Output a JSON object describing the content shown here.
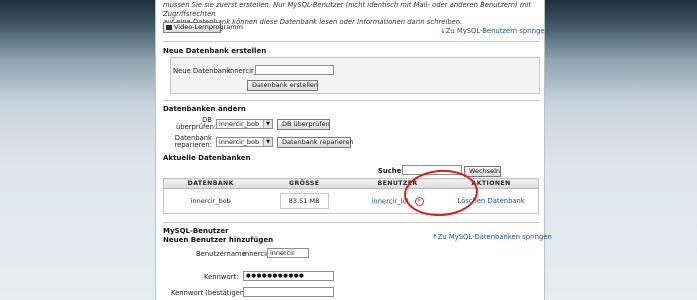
{
  "intro": {
    "line1": "müssen Sie sie zuerst erstellen. Nur MySQL-Benutzer (nicht identisch mit Mail- oder anderen Benutzern) mit Zugriffsrechten",
    "line2": "auf eine Datenbank können diese Datenbank lesen oder Informationen darin schreiben."
  },
  "video_button": "Video-Lernprogramm",
  "jump_users_link": "Zu MySQL-Benutzern springen",
  "create_db": {
    "heading": "Neue Datenbank erstellen",
    "label": "Neue Datenbank:",
    "prefix": "innercir_",
    "value": "",
    "button": "Datenbank erstellen"
  },
  "modify_db": {
    "heading": "Datenbanken ändern",
    "check_label_1": "DB",
    "check_label_2": "überprüfen:",
    "check_select": "innercir_bob",
    "check_button": "DB überprüfen",
    "repair_label_1": "Datenbank",
    "repair_label_2": "reparieren:",
    "repair_select": "innercir_bob",
    "repair_button": "Datenbank reparieren"
  },
  "current_db": {
    "heading": "Aktuelle Datenbanken",
    "search_label": "Suchen",
    "search_value": "",
    "search_button": "Wechseln",
    "columns": [
      "DATENBANK",
      "GRÖSSE",
      "BENUTZER",
      "AKTIONEN"
    ],
    "rows": [
      {
        "database": "innercir_bob",
        "size": "83.51 MB",
        "user": "innercir_lol",
        "action": "Löschen Datenbank"
      }
    ]
  },
  "mysql_users": {
    "heading": "MySQL-Benutzer",
    "subheading": "Neuen Benutzer hinzufügen",
    "jump_db_link": "Zu MySQL-Datenbanken springen",
    "username_label": "Benutzername",
    "username_prefix": "innercir_",
    "username_value": "innercir",
    "password_label": "Kennwort:",
    "password_value": "●●●●●●●●●●●",
    "password_confirm_label": "Kennwort (bestätigen):"
  },
  "colors": {
    "highlight_circle": "#d21f1f",
    "link": "#1d4f8c"
  },
  "icons": {
    "delete_user": "x-circle-icon",
    "arrow_down": "arrow-down-icon",
    "arrow_up": "arrow-up-icon",
    "video": "video-icon"
  }
}
